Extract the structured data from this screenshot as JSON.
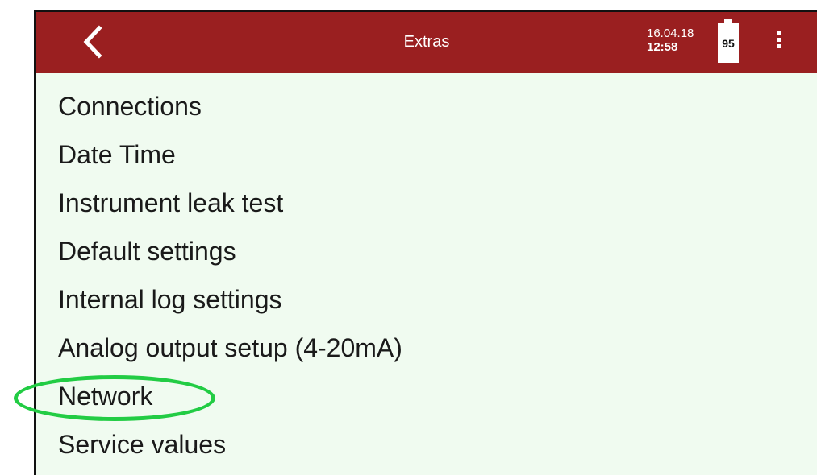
{
  "appbar": {
    "title": "Extras",
    "date": "16.04.18",
    "time": "12:58",
    "battery_level": "95",
    "background_color": "#9a1f20",
    "back_icon": "chevron-left-icon",
    "menu_icon": "more-vertical-icon"
  },
  "menu": {
    "items": [
      {
        "label": "Connections"
      },
      {
        "label": "Date Time"
      },
      {
        "label": "Instrument leak test"
      },
      {
        "label": "Default settings"
      },
      {
        "label": "Internal log settings"
      },
      {
        "label": "Analog output setup (4-20mA)"
      },
      {
        "label": "Network",
        "highlighted": true
      },
      {
        "label": "Service values"
      }
    ]
  },
  "colors": {
    "list_background": "#f0fbf0",
    "highlight_ring": "#22cc44"
  }
}
